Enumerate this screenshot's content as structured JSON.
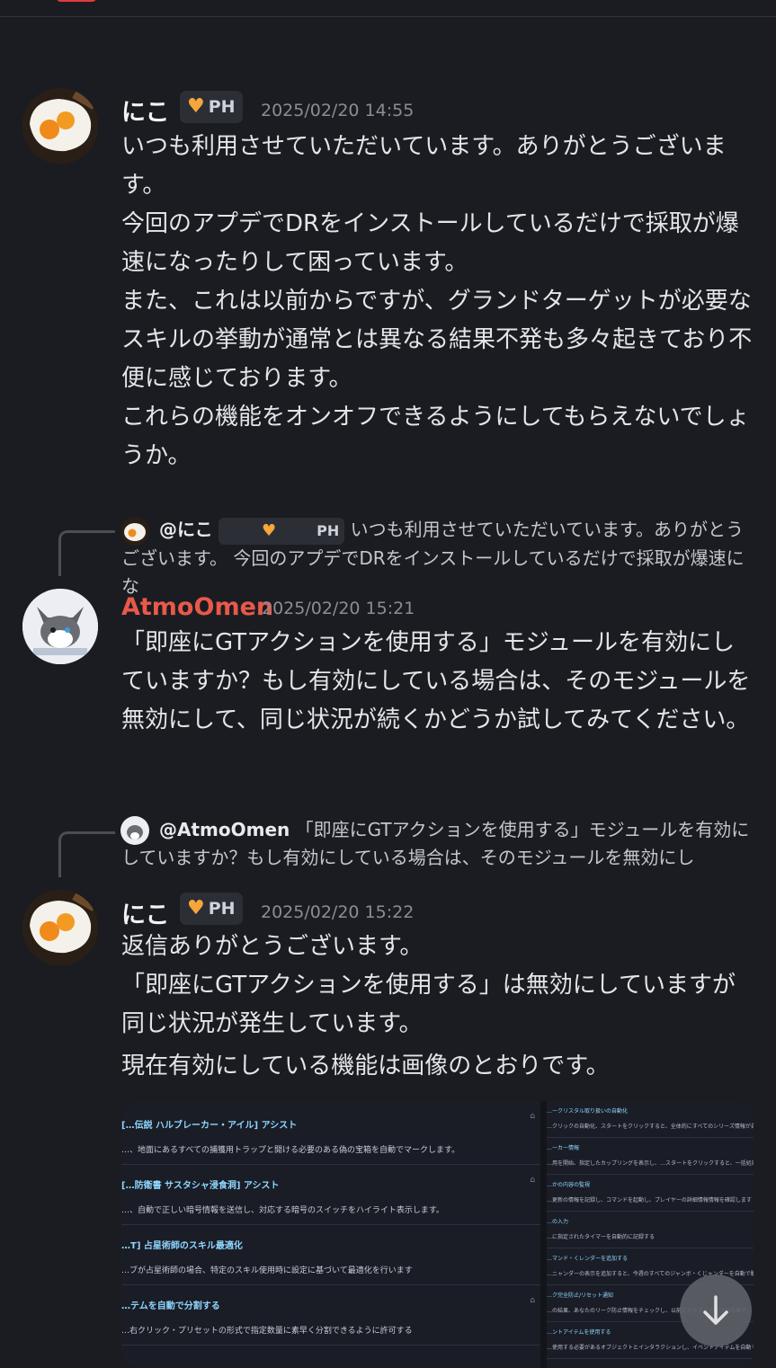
{
  "messages": [
    {
      "author": "にこ",
      "badge": "PH",
      "timestamp": "2025/02/20 14:55",
      "lines": [
        "いつも利用させていただいています。ありがとうございます。",
        "今回のアプデでDRをインストールしているだけで採取が爆速になったりして困っています。",
        "また、これは以前からですが、グランドターゲットが必要なスキルの挙動が通常とは異なる結果不発も多々起きており不便に感じております。",
        "これらの機能をオンオフできるようにしてもらえないでしょうか。"
      ]
    },
    {
      "reply": {
        "mention": "@にこ",
        "badge": "PH",
        "preview": "いつも利用させていただいています。ありがとうございます。 今回のアプデでDRをインストールしているだけで採取が爆速にな"
      },
      "author": "AtmoOmen",
      "author_color": "#e8594a",
      "timestamp": "2025/02/20 15:21",
      "lines": [
        "「即座にGTアクションを使用する」モジュールを有効にしていますか？もし有効にしている場合は、そのモジュールを無効にして、同じ状況が続くかどうか試してみてください。"
      ]
    },
    {
      "reply": {
        "mention": "@AtmoOmen",
        "preview": "「即座にGTアクションを使用する」モジュールを有効にしていますか？もし有効にしている場合は、そのモジュールを無効にし"
      },
      "author": "にこ",
      "badge": "PH",
      "timestamp": "2025/02/20 15:22",
      "lines": [
        "返信ありがとうございます。",
        "「即座にGTアクションを使用する」は無効にしていますが同じ状況が発生しています。",
        "現在有効にしている機能は画像のとおりです。"
      ]
    }
  ],
  "attachment_left": [
    {
      "title": "[…伝説 ハルブレーカー・アイル] アシスト",
      "desc": "…、地面にあるすべての捕獲用トラップと開ける必要のある偽の宝箱を自動でマークします。"
    },
    {
      "title": "[…防衛書 サスタシャ浸食洞] アシスト",
      "desc": "…、自動で正しい暗号情報を送信し、対応する暗号のスイッチをハイライト表示します。"
    },
    {
      "title": "…T] 占星術師のスキル最適化",
      "desc": "…ブが占星術師の場合、特定のスキル使用時に設定に基づいて最適化を行います"
    },
    {
      "title": "…テムを自動で分割する",
      "desc": "…右クリック・プリセットの形式で指定数量に素早く分割できるように許可する"
    }
  ],
  "attachment_right": [
    {
      "title": "…ークリスタル取り扱いの自動化",
      "desc": "…クリックの自動化、スタートをクリックすると、全体的にすべてのシリーズ情報が自動で取得する。"
    },
    {
      "title": "…ーカー情報",
      "desc": "…用を開始、指定したカップリングを表示し、…スタートをクリックすると、一括処理します。"
    },
    {
      "title": "…かの内容の監視",
      "desc": "…更新の情報を記録し、コマンドを起動し、プレイヤーの詳細情報情報を確認します"
    },
    {
      "title": "…の入力",
      "desc": "…に指定されたタイマーを自動的に記録する"
    },
    {
      "title": "…マンド・くレンダーを追加する",
      "desc": "…ニャンダーの表示を追加すると、今週のすべてのジャンボ・くじャンダーを自動で購入します"
    },
    {
      "title": "…ク完全防止/リセット通知",
      "desc": "…の結果、あなたのリーク防止情報をチェックし、以前になるタイミングの結果が…"
    },
    {
      "title": "…ントアイテムを使用する",
      "desc": "…使用する必要があるオブジェクトとインタラクションし、イベントアイテムを自動で使用、自動…"
    }
  ],
  "icons": {
    "heart": "heart-badge-icon",
    "scroll": "arrow-down-icon"
  }
}
